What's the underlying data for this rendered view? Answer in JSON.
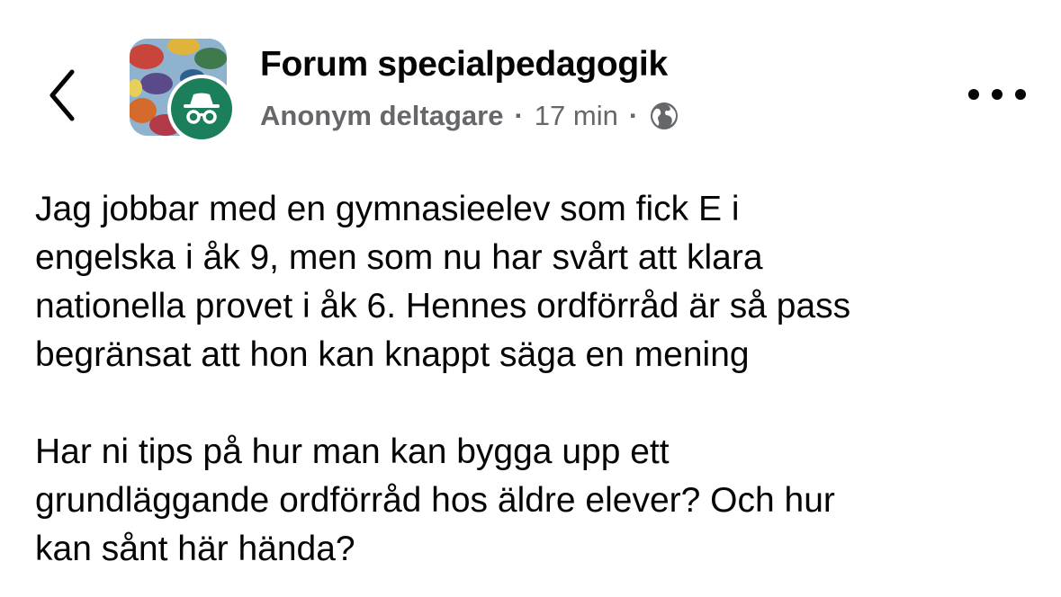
{
  "header": {
    "back_icon": "chevron-left-icon",
    "group_name": "Forum specialpedagogik",
    "avatar_badge_icon": "incognito-icon",
    "author": "Anonym deltagare",
    "separator": "·",
    "time": "17 min",
    "audience_icon": "globe-icon",
    "more_icon": "more-horizontal-icon"
  },
  "post": {
    "paragraphs": [
      "Jag jobbar med en gymnasieelev som fick E i\nengelska i åk 9, men som nu har svårt att klara\nnationella provet i åk 6. Hennes ordförråd är så pass\nbegränsat att hon kan knappt säga en mening",
      "Har ni tips på hur man kan bygga upp ett\ngrundläggande ordförråd hos äldre elever? Och hur\nkan sånt här hända?"
    ]
  },
  "colors": {
    "text": "#050505",
    "meta": "#65676b",
    "anon_badge": "#1a7f5a"
  }
}
